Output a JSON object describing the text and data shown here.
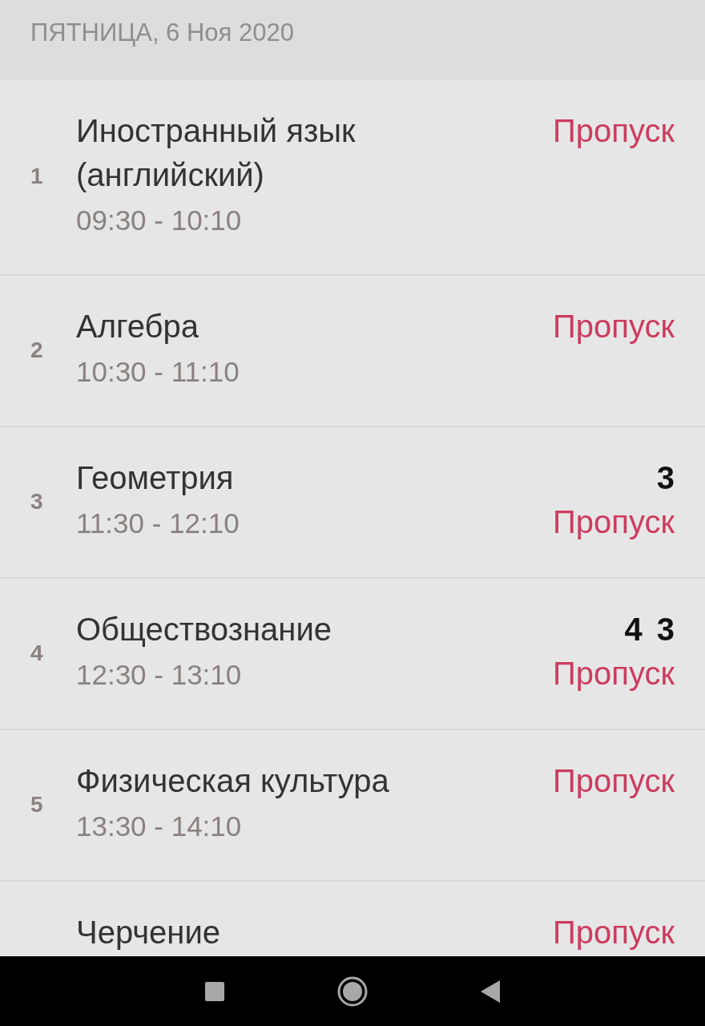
{
  "day_header": "ПЯТНИЦА, 6 Ноя 2020",
  "lessons": [
    {
      "number": "1",
      "subject": "Иностранный язык (английский)",
      "time": "09:30 - 10:10",
      "status": "Пропуск"
    },
    {
      "number": "2",
      "subject": "Алгебра",
      "time": "10:30 - 11:10",
      "status": "Пропуск"
    },
    {
      "number": "3",
      "subject": "Геометрия",
      "time": "11:30 - 12:10",
      "marks": [
        "3"
      ],
      "status": "Пропуск"
    },
    {
      "number": "4",
      "subject": "Обществознание",
      "time": "12:30 - 13:10",
      "marks": [
        "4",
        "3"
      ],
      "status": "Пропуск"
    },
    {
      "number": "5",
      "subject": "Физическая культура",
      "time": "13:30 - 14:10",
      "status": "Пропуск"
    },
    {
      "subject": "Черчение",
      "status": "Пропуск"
    }
  ]
}
